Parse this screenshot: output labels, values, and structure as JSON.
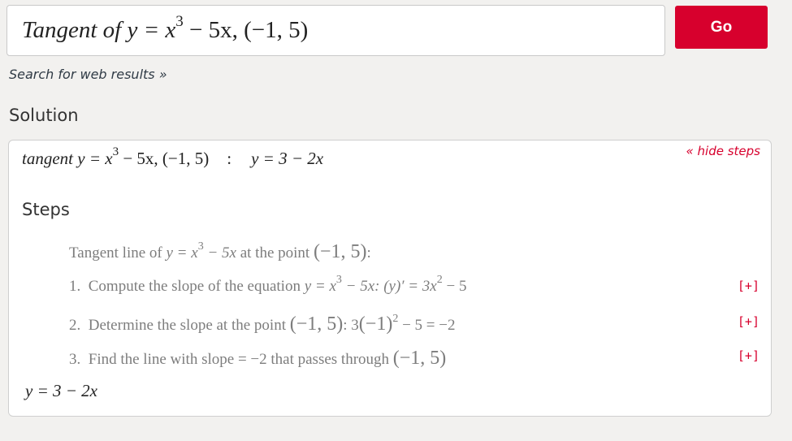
{
  "search": {
    "query_prefix": "Tangent of ",
    "query_math_a": "y = x",
    "query_exp": "3",
    "query_math_b": " − 5x, ",
    "query_point": "(−1, 5)"
  },
  "go_button": {
    "label": "Go"
  },
  "web_results_link": "Search for web results »",
  "solution": {
    "heading": "Solution",
    "hide_steps": "« hide steps",
    "result": {
      "word": "tangent ",
      "math_a": "y = x",
      "exp": "3",
      "math_b": " − 5x, (−1, 5)",
      "colon": ":",
      "answer": "y = 3 − 2x"
    },
    "steps_heading": "Steps",
    "intro": {
      "prefix": "Tangent line of ",
      "math_a": "y = x",
      "exp": "3",
      "math_b": " − 5x",
      "mid": " at the point ",
      "point": "(−1, 5)",
      "suffix": ":"
    },
    "steps": [
      {
        "number": "1.",
        "prefix": "Compute the slope of the equation ",
        "math_a": "y = x",
        "exp": "3",
        "math_b": " − 5x:  ",
        "deriv_a": "(y)′ = 3x",
        "deriv_exp": "2",
        "deriv_b": " − 5",
        "expand": "[+]"
      },
      {
        "number": "2.",
        "prefix": "Determine the slope at the point ",
        "point": "(−1, 5)",
        "mid": ":  3",
        "paren_term": "(−1)",
        "exp": "2",
        "rest": " − 5 = −2",
        "expand": "[+]"
      },
      {
        "number": "3.",
        "prefix": "Find the line with slope",
        "eq": " = −2",
        "mid": " that passes through ",
        "point": "(−1, 5)",
        "expand": "[+]"
      }
    ],
    "final_answer": "y = 3 − 2x"
  },
  "colors": {
    "accent": "#d7002d",
    "background": "#f2f1ef",
    "step_text": "#7d7d7d"
  }
}
